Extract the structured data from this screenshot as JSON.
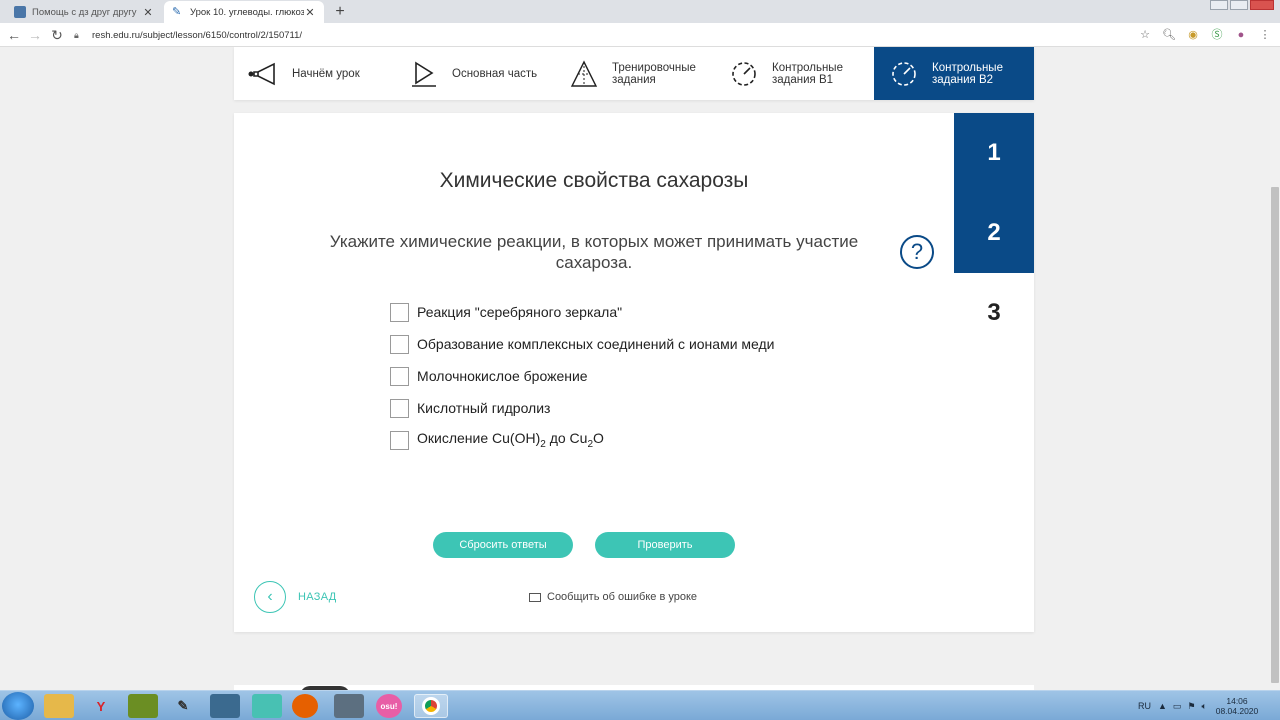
{
  "browser": {
    "tabs": [
      {
        "title": "Помощь с дз друг другу",
        "active": false
      },
      {
        "title": "Урок 10. углеводы. глюкоза. оли",
        "active": true
      }
    ],
    "url": "resh.edu.ru/subject/lesson/6150/control/2/150711/"
  },
  "steps": [
    {
      "label": "Начнём урок",
      "icon": "megaphone-icon",
      "active": false
    },
    {
      "label": "Основная часть",
      "icon": "play-icon",
      "active": false
    },
    {
      "label": "Тренировочные задания",
      "icon": "triangle-icon",
      "active": false
    },
    {
      "label": "Контрольные задания В1",
      "icon": "timer-icon",
      "active": false
    },
    {
      "label": "Контрольные задания В2",
      "icon": "timer-icon",
      "active": true
    }
  ],
  "task": {
    "title": "Химические свойства сахарозы",
    "question": "Укажите химические реакции, в которых может принимать участие сахароза.",
    "help_symbol": "?",
    "options": [
      {
        "text": "Реакция \"серебряного зеркала\"",
        "checked": false
      },
      {
        "text": "Образование комплексных соединений с ионами меди",
        "checked": false
      },
      {
        "text": "Молочнокислое брожение",
        "checked": false
      },
      {
        "text": "Кислотный гидролиз",
        "checked": false
      },
      {
        "prefix": "Окисление Cu(OH)",
        "sub1": "2",
        "mid": " до Cu",
        "sub2": "2",
        "suffix": "O",
        "checked": false
      }
    ],
    "numbers": [
      {
        "label": "1",
        "done": true
      },
      {
        "label": "2",
        "done": true
      },
      {
        "label": "3",
        "done": false
      }
    ]
  },
  "buttons": {
    "reset": "Сбросить ответы",
    "check": "Проверить"
  },
  "footer": {
    "back": "НАЗАД",
    "report": "Сообщить об ошибке в уроке"
  },
  "taskbar": {
    "lang": "RU",
    "time": "14:06",
    "date": "08.04.2020"
  }
}
